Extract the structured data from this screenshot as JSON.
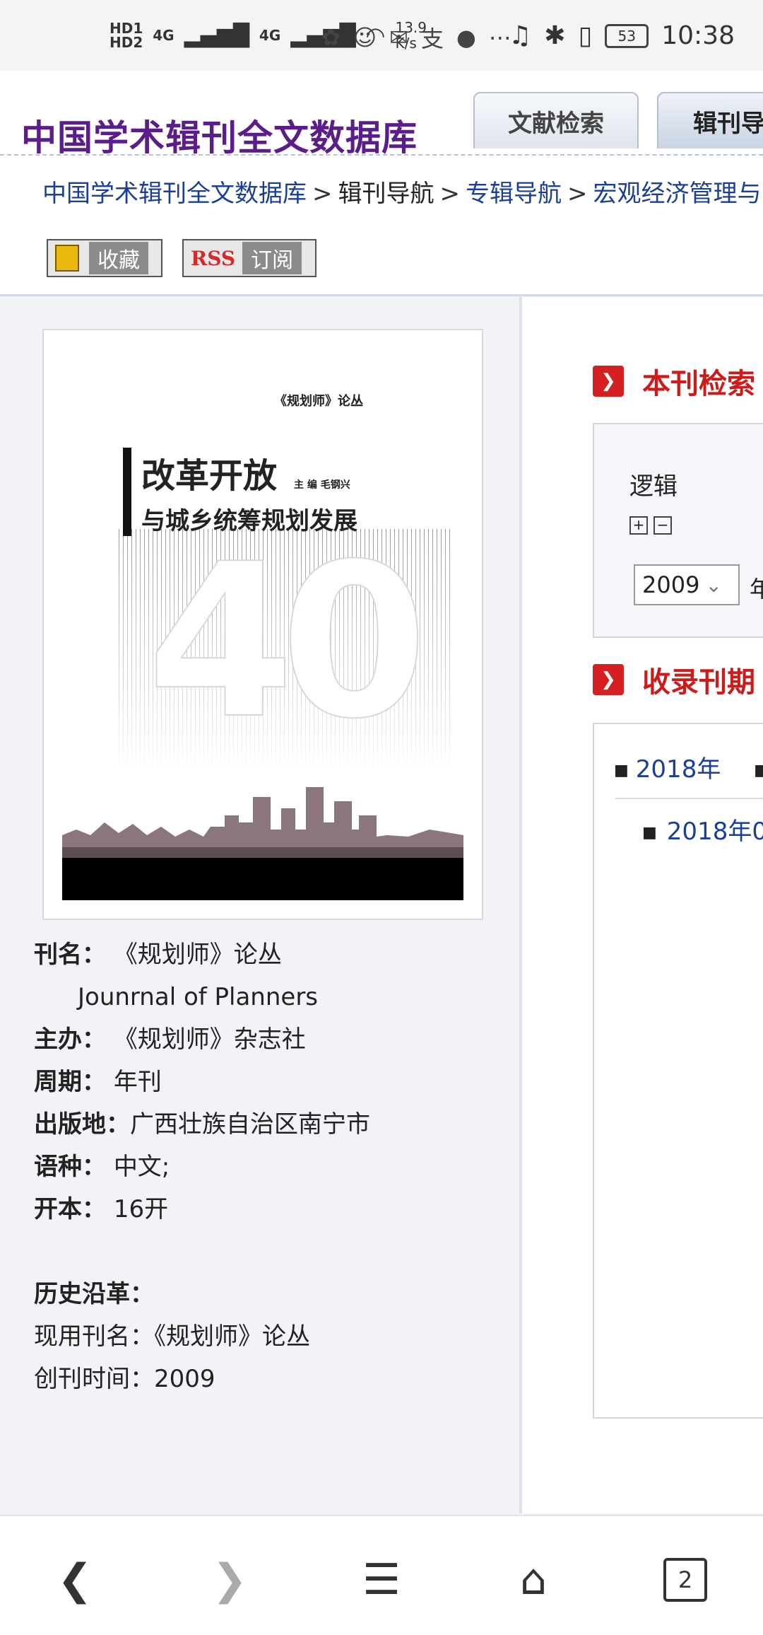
{
  "status_bar": {
    "hd1": "HD1",
    "hd2": "HD2",
    "net1": "4G",
    "net2": "4G",
    "speed_value": "13.9",
    "speed_unit": "K/s",
    "battery": "53",
    "time": "10:38"
  },
  "header": {
    "site_title": "中国学术辑刊全文数据库",
    "tabs": [
      "文献检索",
      "辑刊导"
    ]
  },
  "breadcrumb": {
    "items": [
      "中国学术辑刊全文数据库",
      "辑刊导航",
      "专辑导航",
      "宏观经济管理与"
    ],
    "separator": ">"
  },
  "actions": {
    "favorite_label": "收藏",
    "rss_tag": "RSS",
    "rss_label": "订阅"
  },
  "cover": {
    "series": "《规划师》论丛",
    "title_line1": "改革开放",
    "editor": "主 编   毛钢兴",
    "title_line2": "与城乡统筹规划发展",
    "big_number": "40"
  },
  "journal_info": {
    "name_label": "刊名：",
    "name_value": "《规划师》论丛",
    "english_name": "Jounrnal of Planners",
    "sponsor_label": "主办：",
    "sponsor_value": "《规划师》杂志社",
    "period_label": "周期：",
    "period_value": "年刊",
    "place_label": "出版地：",
    "place_value": "广西壮族自治区南宁市",
    "language_label": "语种：",
    "language_value": "中文;",
    "format_label": "开本：",
    "format_value": "16开"
  },
  "history": {
    "heading": "历史沿革：",
    "current_name": "现用刊名：《规划师》论丛",
    "founded": "创刊时间：2009"
  },
  "search_section": {
    "title": "本刊检索",
    "logic_label": "逻辑",
    "year_value": "2009",
    "year_suffix": "年"
  },
  "issues_section": {
    "title": "收录刊期",
    "year_tab": "2018年",
    "issue": "2018年0"
  },
  "bottom_nav": {
    "tab_count": "2"
  }
}
